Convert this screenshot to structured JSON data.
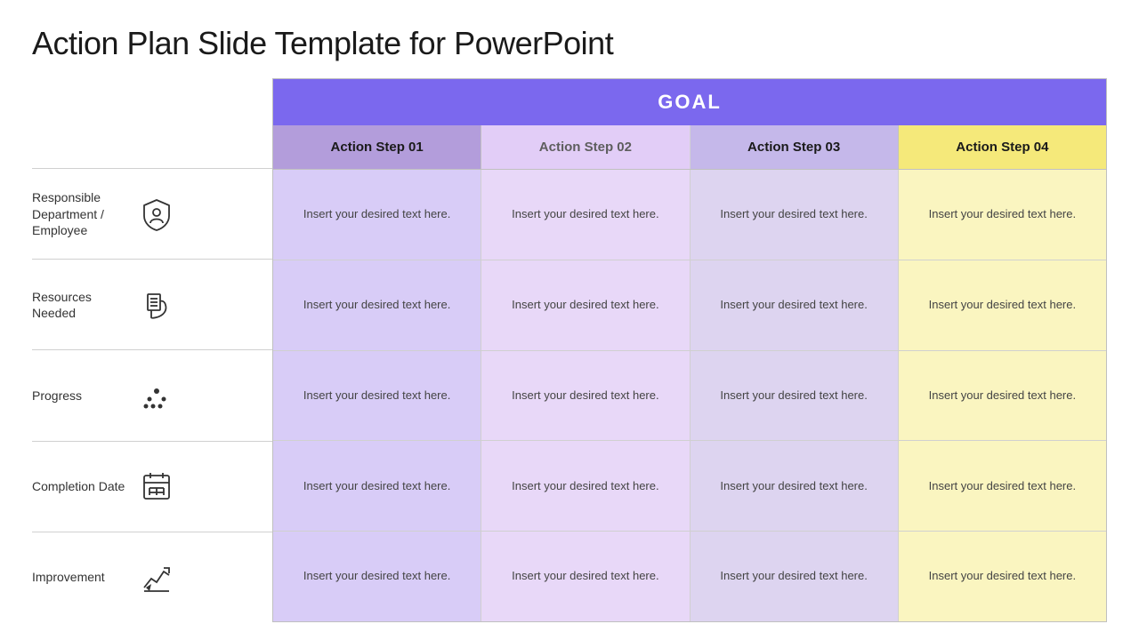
{
  "title": "Action Plan Slide Template for PowerPoint",
  "goal": {
    "label": "GOAL",
    "bg": "#7b68ee"
  },
  "steps": [
    {
      "label": "Action Step 01",
      "colorClass": "col1"
    },
    {
      "label": "Action Step 02",
      "colorClass": "col2"
    },
    {
      "label": "Action Step 03",
      "colorClass": "col3"
    },
    {
      "label": "Action Step 04",
      "colorClass": "col4"
    }
  ],
  "rows": [
    {
      "label": "Responsible Department / Employee",
      "icon": "shield",
      "cells": [
        "Insert your desired text here.",
        "Insert your desired text here.",
        "Insert your desired text here.",
        "Insert your desired text here."
      ]
    },
    {
      "label": "Resources Needed",
      "icon": "resources",
      "cells": [
        "Insert your desired text here.",
        "Insert your desired text here.",
        "Insert your desired text here.",
        "Insert your desired text here."
      ]
    },
    {
      "label": "Progress",
      "icon": "progress",
      "cells": [
        "Insert your desired text here.",
        "Insert your desired text here.",
        "Insert your desired text here.",
        "Insert your desired text here."
      ]
    },
    {
      "label": "Completion Date",
      "icon": "calendar",
      "cells": [
        "Insert your desired text here.",
        "Insert your desired text here.",
        "Insert your desired text here.",
        "Insert your desired text here."
      ]
    },
    {
      "label": "Improvement",
      "icon": "improvement",
      "cells": [
        "Insert your desired text here.",
        "Insert your desired text here.",
        "Insert your desired text here.",
        "Insert your desired text here."
      ]
    }
  ]
}
